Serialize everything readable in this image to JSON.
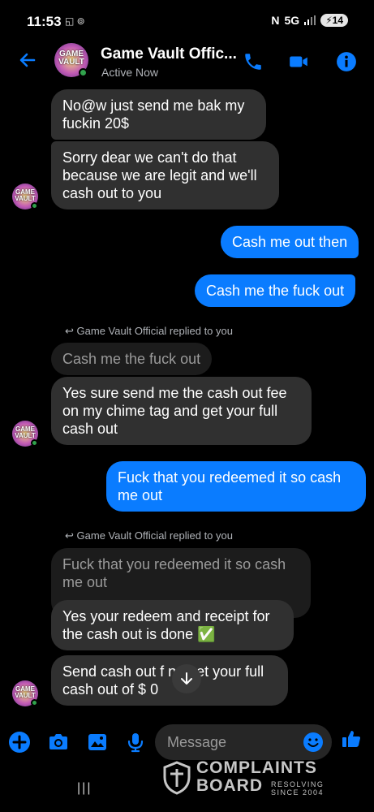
{
  "status_bar": {
    "time": "11:53",
    "left_icons": "◱ ⊚",
    "network": "5G",
    "battery": "14"
  },
  "header": {
    "name": "Game Vault Offic...",
    "status": "Active Now",
    "avatar_logo": "GAME VAULT"
  },
  "messages": {
    "m1": "No@w just send me bak my fuckin 20$",
    "m2": "Sorry dear we can't do that because we are legit and we'll cash out to you",
    "m3": "Cash me out then",
    "m4": "Cash me the fuck out",
    "reply1_label": "Game Vault Official  replied to you",
    "q1": "Cash me the fuck out",
    "m5": "Yes sure send me the cash out fee on my chime tag and get your full cash out",
    "m6": "Fuck that you redeemed it so cash me out",
    "reply2_label": "Game Vault Official  replied to you",
    "q2": "Fuck that you redeemed it so cash me out",
    "m7": "Yes your redeem and receipt for the cash out is done ✅",
    "m8": "Send cash out f     nd get your full cash out of $    0"
  },
  "composer": {
    "placeholder": "Message"
  },
  "watermark": {
    "title1": "COMPLAINTS",
    "title2": "BOARD",
    "sub1": "RESOLVING",
    "sub2": "SINCE 2004"
  },
  "colors": {
    "accent": "#0a7cff",
    "incoming": "#303030",
    "quoted": "#1c1c1c",
    "online": "#31a24c"
  },
  "icons": [
    "back-arrow-icon",
    "phone-icon",
    "video-icon",
    "info-icon",
    "plus-icon",
    "camera-icon",
    "gallery-icon",
    "mic-icon",
    "emoji-icon",
    "like-icon",
    "reply-icon",
    "arrow-down-icon"
  ]
}
